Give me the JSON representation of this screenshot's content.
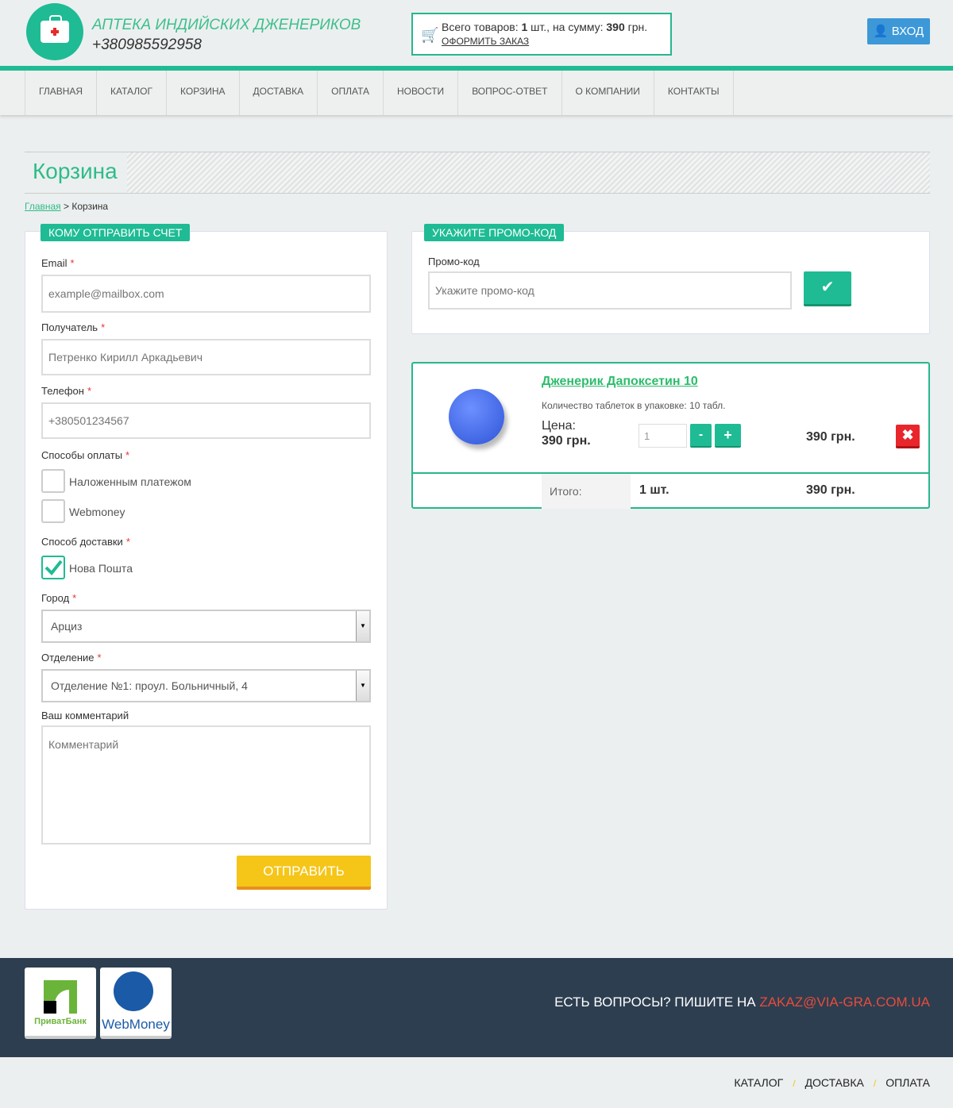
{
  "header": {
    "brand": "АПТЕКА ИНДИЙСКИХ ДЖЕНЕРИКОВ",
    "phone": "+380985592958",
    "cart_prefix": "Всего товаров: ",
    "cart_count": "1",
    "cart_mid": " шт., на сумму: ",
    "cart_sum": "390",
    "cart_suffix": " грн.",
    "checkout": "ОФОРМИТЬ ЗАКАЗ",
    "login": "ВХОД"
  },
  "nav": [
    "ГЛАВНАЯ",
    "КАТАЛОГ",
    "КОРЗИНА",
    "ДОСТАВКА",
    "ОПЛАТА",
    "НОВОСТИ",
    "ВОПРОС-ОТВЕТ",
    "О КОМПАНИИ",
    "КОНТАКТЫ"
  ],
  "page": {
    "title": "Корзина",
    "crumb_home": "Главная",
    "crumb_sep": " > ",
    "crumb_current": "Корзина"
  },
  "form": {
    "tag": "КОМУ ОТПРАВИТЬ СЧЕТ",
    "email_label": "Email",
    "email_ph": "example@mailbox.com",
    "name_label": "Получатель",
    "name_ph": "Петренко Кирилл Аркадьевич",
    "phone_label": "Телефон",
    "phone_ph": "+380501234567",
    "payment_label": "Способы оплаты",
    "payment_options": [
      {
        "label": "Наложенным платежом",
        "checked": false
      },
      {
        "label": "Webmoney",
        "checked": false
      }
    ],
    "delivery_label": "Способ доставки",
    "delivery_options": [
      {
        "label": "Нова Пошта",
        "checked": true
      }
    ],
    "city_label": "Город",
    "city_value": "Арциз",
    "branch_label": "Отделение",
    "branch_value": "Отделение №1: проул. Больничный, 4",
    "comment_label": "Ваш комментарий",
    "comment_ph": "Комментарий",
    "submit": "ОТПРАВИТЬ",
    "required": "*"
  },
  "promo": {
    "tag": "УКАЖИТЕ ПРОМО-КОД",
    "label": "Промо-код",
    "placeholder": "Укажите промо-код"
  },
  "cart": {
    "item": {
      "name": "Дженерик Дапоксетин 10",
      "desc": "Количество таблеток в упаковке: 10 табл.",
      "price_label": "Цена:",
      "price": "390 грн.",
      "qty": "1",
      "minus": "-",
      "plus": "+",
      "total": "390 грн."
    },
    "total_label": "Итого:",
    "total_qty": "1 шт.",
    "total_sum": "390 грн."
  },
  "footer": {
    "privat": "ПриватБанк",
    "webmoney": "WebMoney",
    "question": "ЕСТЬ ВОПРОСЫ? ПИШИТЕ НА ",
    "email": "ZAKAZ@VIA-GRA.COM.UA",
    "email_color": "#e74c3c"
  },
  "bottom_nav": [
    "КАТАЛОГ",
    "ДОСТАВКА",
    "ОПЛАТА"
  ],
  "colors": {
    "accent": "#1fbb94",
    "submit": "#f5c518",
    "footer_bg": "#2d3e50",
    "login": "#3d98d8"
  }
}
